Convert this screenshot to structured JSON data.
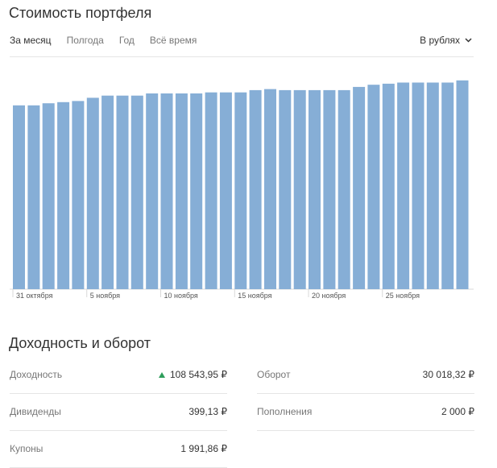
{
  "portfolio": {
    "title": "Стоимость портфеля",
    "tabs": [
      {
        "label": "За месяц",
        "active": true
      },
      {
        "label": "Полгода",
        "active": false
      },
      {
        "label": "Год",
        "active": false
      },
      {
        "label": "Всё время",
        "active": false
      }
    ],
    "currency": {
      "label": "В рублях",
      "icon": "chevron-down-icon"
    }
  },
  "chart_data": {
    "type": "bar",
    "bar_color": "#86aed6",
    "x_tick_labels": [
      {
        "label": "31 октября",
        "at_bar": 0
      },
      {
        "label": "5 ноября",
        "at_bar": 5
      },
      {
        "label": "10 ноября",
        "at_bar": 10
      },
      {
        "label": "15 ноября",
        "at_bar": 15
      },
      {
        "label": "20 ноября",
        "at_bar": 20
      },
      {
        "label": "25 ноября",
        "at_bar": 25
      }
    ],
    "values_relative": [
      0.845,
      0.845,
      0.855,
      0.86,
      0.865,
      0.88,
      0.89,
      0.89,
      0.89,
      0.9,
      0.9,
      0.9,
      0.9,
      0.905,
      0.905,
      0.905,
      0.915,
      0.92,
      0.915,
      0.915,
      0.915,
      0.915,
      0.915,
      0.93,
      0.94,
      0.945,
      0.95,
      0.95,
      0.95,
      0.95,
      0.96
    ]
  },
  "returns": {
    "title": "Доходность и оборот",
    "trend_color": "#2e9e5b",
    "left": [
      {
        "label": "Доходность",
        "value": "108 543,95 ₽",
        "trend": "up"
      },
      {
        "label": "Дивиденды",
        "value": "399,13 ₽"
      },
      {
        "label": "Купоны",
        "value": "1 991,86 ₽"
      }
    ],
    "right": [
      {
        "label": "Оборот",
        "value": "30 018,32 ₽"
      },
      {
        "label": "Пополнения",
        "value": "2 000 ₽"
      }
    ]
  }
}
